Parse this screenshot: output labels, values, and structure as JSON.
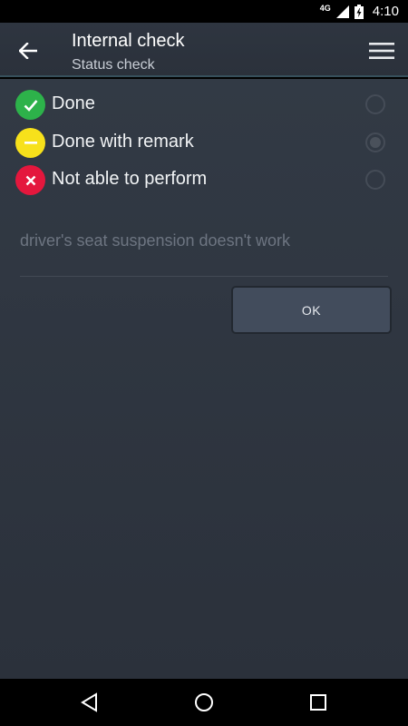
{
  "status_bar": {
    "network": "4G",
    "time": "4:10"
  },
  "app_bar": {
    "title": "Internal check",
    "subtitle": "Status check"
  },
  "options": [
    {
      "label": "Done",
      "color": "#2db24a",
      "icon": "check-icon",
      "selected": false
    },
    {
      "label": "Done with remark",
      "color": "#f7e11b",
      "icon": "minus-icon",
      "selected": true
    },
    {
      "label": "Not able to perform",
      "color": "#e4173d",
      "icon": "x-icon",
      "selected": false
    }
  ],
  "remark": {
    "value": "driver's seat suspension doesn't work"
  },
  "ok_button": {
    "label": "OK"
  },
  "colors": {
    "background": "#2f3640",
    "app_bar": "#2e3540",
    "button": "#424c5c"
  }
}
